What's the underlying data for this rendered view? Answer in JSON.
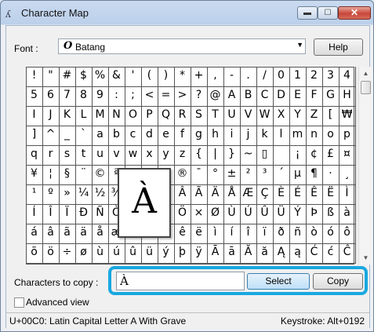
{
  "window": {
    "title": "Character Map",
    "app_icon": "character-map-icon",
    "controls": [
      "minimize",
      "maximize",
      "close"
    ],
    "close_glyph": "✕",
    "minimize_glyph": "▬",
    "maximize_glyph": "☐"
  },
  "font": {
    "label": "Font :",
    "value": "Batang",
    "type_glyph": "O",
    "help_label": "Help"
  },
  "grid": {
    "columns": 20,
    "rows": [
      [
        "!",
        "\"",
        "#",
        "$",
        "%",
        "&",
        "'",
        "(",
        ")",
        "*",
        "+",
        ",",
        "-",
        ".",
        "/",
        "0",
        "1",
        "2",
        "3",
        "4"
      ],
      [
        "5",
        "6",
        "7",
        "8",
        "9",
        ":",
        ";",
        "<",
        "=",
        ">",
        "?",
        "@",
        "A",
        "B",
        "C",
        "D",
        "E",
        "F",
        "G",
        "H"
      ],
      [
        "I",
        "J",
        "K",
        "L",
        "M",
        "N",
        "O",
        "P",
        "Q",
        "R",
        "S",
        "T",
        "U",
        "V",
        "W",
        "X",
        "Y",
        "Z",
        "[",
        "₩"
      ],
      [
        "]",
        "^",
        "_",
        "`",
        "a",
        "b",
        "c",
        "d",
        "e",
        "f",
        "g",
        "h",
        "i",
        "j",
        "k",
        "l",
        "m",
        "n",
        "o",
        "p"
      ],
      [
        "q",
        "r",
        "s",
        "t",
        "u",
        "v",
        "w",
        "x",
        "y",
        "z",
        "{",
        "|",
        "}",
        "~",
        "▯",
        " ",
        "¡",
        "¢",
        "£",
        "¤"
      ],
      [
        "¥",
        "¦",
        "§",
        "¨",
        "©",
        "ª",
        "«",
        "¬",
        "-",
        "®",
        "¯",
        "°",
        "±",
        "²",
        "³",
        "´",
        "µ",
        "¶",
        "·",
        "¸"
      ],
      [
        "¹",
        "º",
        "»",
        "¼",
        "½",
        "¾",
        "¿",
        "À",
        "Á",
        "Â",
        "Ã",
        "Ä",
        "Å",
        "Æ",
        "Ç",
        "È",
        "É",
        "Ê",
        "Ë",
        "Ì"
      ],
      [
        "Í",
        "Î",
        "Ï",
        "Ð",
        "Ñ",
        "Ò",
        "Ó",
        "Ô",
        "Õ",
        "Ö",
        "×",
        "Ø",
        "Ù",
        "Ú",
        "Û",
        "Ü",
        "Ý",
        "Þ",
        "ß",
        "à"
      ],
      [
        "á",
        "â",
        "ã",
        "ä",
        "å",
        "æ",
        "ç",
        "è",
        "é",
        "ê",
        "ë",
        "ì",
        "í",
        "î",
        "ï",
        "ð",
        "ñ",
        "ò",
        "ó",
        "ô"
      ],
      [
        "õ",
        "ö",
        "÷",
        "ø",
        "ù",
        "ú",
        "û",
        "ü",
        "ý",
        "þ",
        "ÿ",
        "Ā",
        "ā",
        "Ă",
        "ă",
        "Ą",
        "ą",
        "Ć",
        "ć",
        "Ĉ"
      ]
    ],
    "magnified_char": "À"
  },
  "scrollbar": {
    "up_glyph": "▲",
    "down_glyph": "▼"
  },
  "copy": {
    "label": "Characters to copy :",
    "value": "À",
    "select_label": "Select",
    "copy_label": "Copy"
  },
  "advanced": {
    "label": "Advanced view",
    "checked": false
  },
  "status": {
    "description": "U+00C0: Latin Capital Letter A With Grave",
    "keystroke": "Keystroke: Alt+0192"
  },
  "colors": {
    "highlight": "#19a8e0",
    "select_button": "#bde0f7"
  }
}
